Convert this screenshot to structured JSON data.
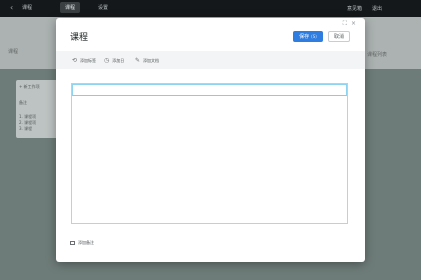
{
  "background": {
    "tabs": [
      "课程",
      "课程",
      "设置"
    ],
    "right_links": [
      "意见箱",
      "退出"
    ],
    "side_label": "课程",
    "card_lines": [
      "+ 新工作项",
      "备注",
      "1. 课程项",
      "2. 课程项",
      "3. 课程"
    ],
    "side_right": "课程列表"
  },
  "modal": {
    "title": "课程",
    "save_label": "保存",
    "save_shortcut": "(S)",
    "cancel_label": "取消",
    "toolbar": [
      {
        "icon": "link-icon",
        "glyph": "⟲",
        "label": "添加标签"
      },
      {
        "icon": "clock-icon",
        "glyph": "◷",
        "label": "添加日"
      },
      {
        "icon": "attachment-icon",
        "glyph": "✎",
        "label": "添加文档"
      }
    ],
    "footer_label": "添加备注",
    "top_icons": [
      "⛶",
      "×"
    ]
  },
  "colors": {
    "accent": "#2f7de1",
    "overlay": "#5b6866"
  }
}
